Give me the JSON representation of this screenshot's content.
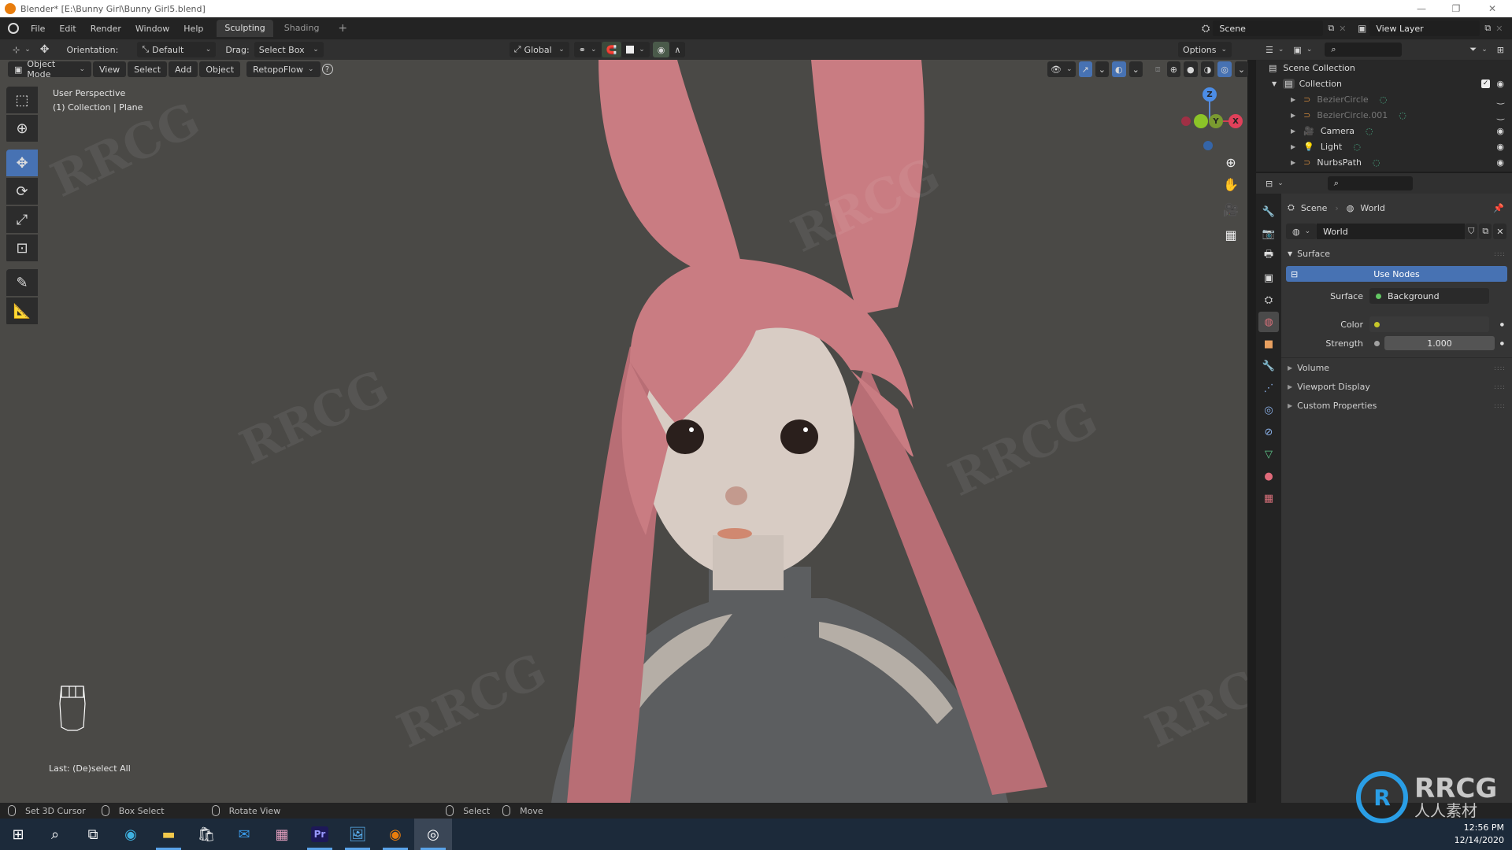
{
  "window": {
    "title": "Blender* [E:\\Bunny Girl\\Bunny Girl5.blend]",
    "controls": [
      "minimize",
      "maximize",
      "close"
    ]
  },
  "topbar": {
    "menus": [
      "File",
      "Edit",
      "Render",
      "Window",
      "Help"
    ],
    "workspace_tabs": [
      {
        "label": "Sculpting",
        "active": true
      },
      {
        "label": "Shading",
        "active": false
      }
    ],
    "add_tab": "+",
    "scene_label": "Scene",
    "view_layer_label": "View Layer"
  },
  "tool_header": {
    "orientation_label": "Orientation:",
    "orientation_value": "Default",
    "drag_label": "Drag:",
    "drag_value": "Select Box",
    "transform_orientation": "Global",
    "options_label": "Options"
  },
  "viewport_header": {
    "mode": "Object Mode",
    "menus": [
      "View",
      "Select",
      "Add",
      "Object"
    ],
    "addon_menu": "RetopoFlow",
    "help_icon": "?"
  },
  "viewport": {
    "perspective": "User Perspective",
    "collection_info": "(1) Collection | Plane",
    "last_operation": "Last: (De)select All",
    "gizmo_axes": {
      "z": "Z",
      "y": "Y",
      "x": "X"
    },
    "colors": {
      "background": "#4a4946",
      "hair": "#c97c82",
      "skin": "#d8ccc4",
      "top": "#5c5e60"
    }
  },
  "toolbar": {
    "tools": [
      "select-box",
      "cursor",
      "move",
      "rotate",
      "scale",
      "transform",
      "annotate",
      "measure"
    ],
    "active_tool": "move"
  },
  "outliner": {
    "root": "Scene Collection",
    "collection": "Collection",
    "items": [
      {
        "name": "BezierCircle",
        "visible": false,
        "icon": "curve-icon",
        "color": "#c8843c"
      },
      {
        "name": "BezierCircle.001",
        "visible": false,
        "icon": "curve-icon",
        "color": "#c8843c"
      },
      {
        "name": "Camera",
        "visible": true,
        "icon": "camera-icon",
        "color": "#c8843c"
      },
      {
        "name": "Light",
        "visible": true,
        "icon": "light-icon",
        "color": "#c8843c"
      },
      {
        "name": "NurbsPath",
        "visible": true,
        "icon": "curve-icon",
        "color": "#c8843c"
      }
    ]
  },
  "properties": {
    "breadcrumb": [
      "Scene",
      "World"
    ],
    "world_name": "World",
    "surface_panel": "Surface",
    "use_nodes_label": "Use Nodes",
    "surface_label": "Surface",
    "surface_value": "Background",
    "color_label": "Color",
    "strength_label": "Strength",
    "strength_value": "1.000",
    "collapsed_panels": [
      "Volume",
      "Viewport Display",
      "Custom Properties"
    ],
    "accent": "#4772b3"
  },
  "statusbar": {
    "items": [
      "Set 3D Cursor",
      "Box Select",
      "Rotate View",
      "Select",
      "Move"
    ]
  },
  "taskbar": {
    "apps": [
      "start",
      "search",
      "task-view",
      "edge",
      "file-explorer",
      "store",
      "mail",
      "app",
      "premiere-pro",
      "photos",
      "blender",
      "obs"
    ],
    "premiere_label": "Pr",
    "time": "12:56 PM",
    "date": "12/14/2020"
  },
  "watermark": {
    "brand": "RRCG",
    "subtitle": "人人素材"
  }
}
